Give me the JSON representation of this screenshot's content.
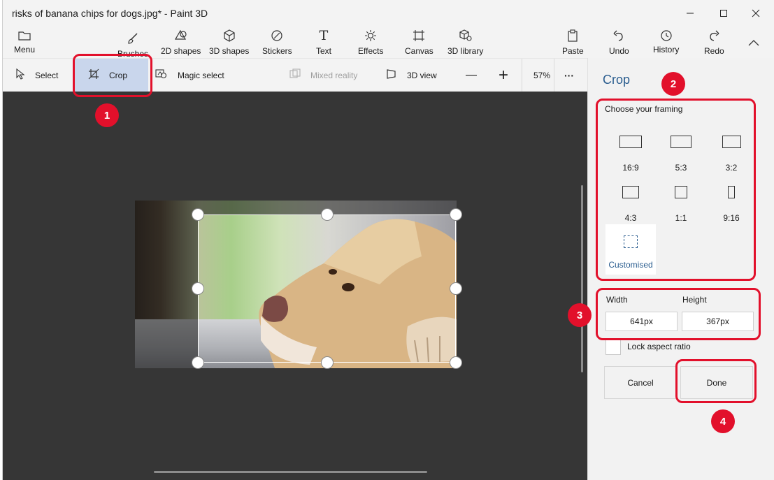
{
  "window": {
    "title": "risks of banana chips for dogs.jpg* - Paint 3D"
  },
  "ribbon": {
    "menu": "Menu",
    "brushes": "Brushes",
    "shapes2d": "2D shapes",
    "shapes3d": "3D shapes",
    "stickers": "Stickers",
    "text": "Text",
    "effects": "Effects",
    "canvas": "Canvas",
    "library3d": "3D library",
    "paste": "Paste",
    "undo": "Undo",
    "history": "History",
    "redo": "Redo"
  },
  "toolbar": {
    "select": "Select",
    "crop": "Crop",
    "magic_select": "Magic select",
    "mixed_reality": "Mixed reality",
    "view3d": "3D view",
    "zoom_minus": "—",
    "zoom_plus": "+",
    "zoom_level": "57%",
    "more": "···"
  },
  "pane": {
    "title": "Crop",
    "subtitle": "Choose your framing",
    "framings": [
      "16:9",
      "5:3",
      "3:2",
      "4:3",
      "1:1",
      "9:16"
    ],
    "customised": "Customised",
    "width_label": "Width",
    "height_label": "Height",
    "width_value": "641px",
    "height_value": "367px",
    "lock_label": "Lock aspect ratio",
    "cancel": "Cancel",
    "done": "Done"
  },
  "annotations": [
    "1",
    "2",
    "3",
    "4"
  ],
  "colors": {
    "accent": "#2a5d8f",
    "annotation": "#e2102b",
    "canvas_bg": "#363636",
    "crop_active": "#c9d6ec"
  }
}
